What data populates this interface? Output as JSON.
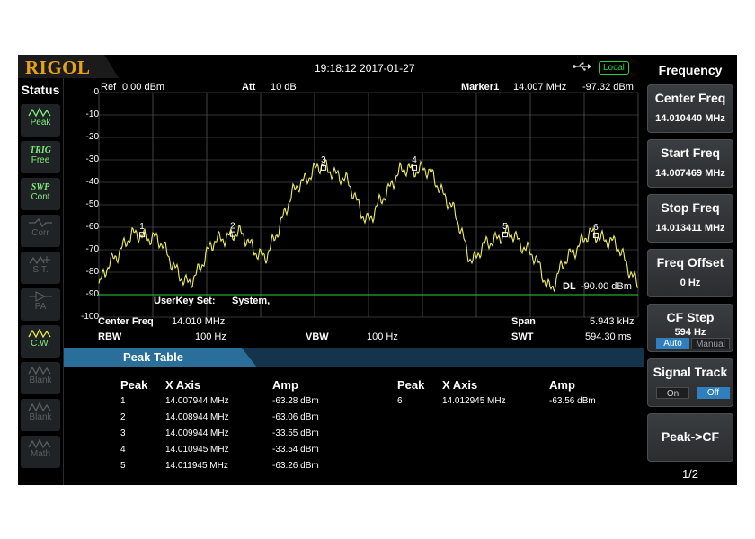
{
  "brand": "RIGOL",
  "datetime": "19:18:12 2017-01-27",
  "remote_mode": "Local",
  "status": {
    "title": "Status",
    "items": [
      {
        "top": "",
        "bottom": "Peak",
        "state": "on"
      },
      {
        "top": "TRIG",
        "bottom": "Free",
        "state": "on"
      },
      {
        "top": "SWP",
        "bottom": "Cont",
        "state": "on"
      },
      {
        "top": "",
        "bottom": "Corr",
        "state": "off"
      },
      {
        "top": "",
        "bottom": "S.T.",
        "state": "off"
      },
      {
        "top": "",
        "bottom": "PA",
        "state": "off"
      },
      {
        "top": "",
        "bottom": "C.W.",
        "state": "on"
      },
      {
        "top": "",
        "bottom": "Blank",
        "state": "off"
      },
      {
        "top": "",
        "bottom": "Blank",
        "state": "off"
      },
      {
        "top": "",
        "bottom": "Math",
        "state": "off"
      }
    ]
  },
  "header": {
    "ref_label": "Ref",
    "ref_value": "0.00 dBm",
    "att_label": "Att",
    "att_value": "10 dB",
    "marker_label": "Marker1",
    "marker_freq": "14.007 MHz",
    "marker_amp": "-97.32 dBm"
  },
  "chart_data": {
    "type": "line",
    "x_unit": "MHz",
    "y_unit": "dBm",
    "ylim": [
      -100,
      0
    ],
    "y_ticks": [
      "0",
      "-10",
      "-20",
      "-30",
      "-40",
      "-50",
      "-60",
      "-70",
      "-80",
      "-90",
      "-100"
    ],
    "xlim": [
      14.0074685,
      14.0134115
    ],
    "grid": true,
    "trace_color": "#f0f060",
    "display_line": {
      "label": "DL",
      "value": "-90.00 dBm",
      "level": -90,
      "color": "#2fcf3a"
    },
    "peaks": [
      {
        "n": "1",
        "x": 14.007944,
        "y": -63.28
      },
      {
        "n": "2",
        "x": 14.008944,
        "y": -63.06
      },
      {
        "n": "3",
        "x": 14.009944,
        "y": -33.55
      },
      {
        "n": "4",
        "x": 14.010945,
        "y": -33.54
      },
      {
        "n": "5",
        "x": 14.011945,
        "y": -63.26
      },
      {
        "n": "6",
        "x": 14.012945,
        "y": -63.56
      }
    ],
    "noise_floor": -93
  },
  "overlay_text": {
    "userkey": "UserKey Set:",
    "system": "System,"
  },
  "footer": {
    "cf_label": "Center Freq",
    "cf_value": "14.010 MHz",
    "span_label": "Span",
    "span_value": "5.943 kHz",
    "rbw_label": "RBW",
    "rbw_value": "100 Hz",
    "vbw_label": "VBW",
    "vbw_value": "100 Hz",
    "swt_label": "SWT",
    "swt_value": "594.30 ms"
  },
  "peak_table": {
    "title": "Peak Table",
    "headers": [
      "Peak",
      "X Axis",
      "Amp"
    ],
    "rows": [
      {
        "peak": "1",
        "x": "14.007944 MHz",
        "amp": "-63.28 dBm"
      },
      {
        "peak": "2",
        "x": "14.008944 MHz",
        "amp": "-63.06 dBm"
      },
      {
        "peak": "3",
        "x": "14.009944 MHz",
        "amp": "-33.55 dBm"
      },
      {
        "peak": "4",
        "x": "14.010945 MHz",
        "amp": "-33.54 dBm"
      },
      {
        "peak": "5",
        "x": "14.011945 MHz",
        "amp": "-63.26 dBm"
      },
      {
        "peak": "6",
        "x": "14.012945 MHz",
        "amp": "-63.56 dBm"
      }
    ]
  },
  "menu": {
    "title": "Frequency",
    "keys": {
      "center": {
        "label": "Center Freq",
        "value": "14.010440 MHz"
      },
      "start": {
        "label": "Start Freq",
        "value": "14.007469 MHz"
      },
      "stop": {
        "label": "Stop Freq",
        "value": "14.013411 MHz"
      },
      "offset": {
        "label": "Freq Offset",
        "value": "0 Hz"
      },
      "cfstep": {
        "label": "CF Step",
        "value": "594 Hz",
        "auto": "Auto",
        "manual": "Manual"
      },
      "track": {
        "label": "Signal Track",
        "on": "On",
        "off": "Off"
      },
      "peakcf": {
        "label": "Peak->CF"
      }
    },
    "page": "1/2"
  },
  "colors": {
    "accent": "#2a6f9a",
    "active_green": "#7ef07a",
    "trace": "#f0f060",
    "selected_blue": "#2f7fbf"
  }
}
